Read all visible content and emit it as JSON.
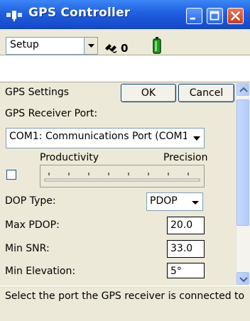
{
  "window": {
    "title": "GPS Controller",
    "colors": {
      "titlebar": "#1f5fe0",
      "panel": "#ece9d8",
      "close": "#c2401f"
    }
  },
  "toolbar": {
    "menu_label": "Setup",
    "satellite_count": "0"
  },
  "section": {
    "title": "GPS Settings",
    "ok_label": "OK",
    "cancel_label": "Cancel"
  },
  "receiver_port": {
    "label": "GPS Receiver Port:",
    "value": "COM1: Communications Port (COM1)"
  },
  "slider": {
    "left_label": "Productivity",
    "right_label": "Precision",
    "checked": false
  },
  "dop_type": {
    "label": "DOP Type:",
    "value": "PDOP"
  },
  "max_pdop": {
    "label": "Max PDOP:",
    "value": "20.0"
  },
  "min_snr": {
    "label": "Min SNR:",
    "value": "33.0"
  },
  "min_elevation": {
    "label": "Min Elevation:",
    "value": "5°"
  },
  "status_text": "Select the port the GPS receiver is connected to"
}
